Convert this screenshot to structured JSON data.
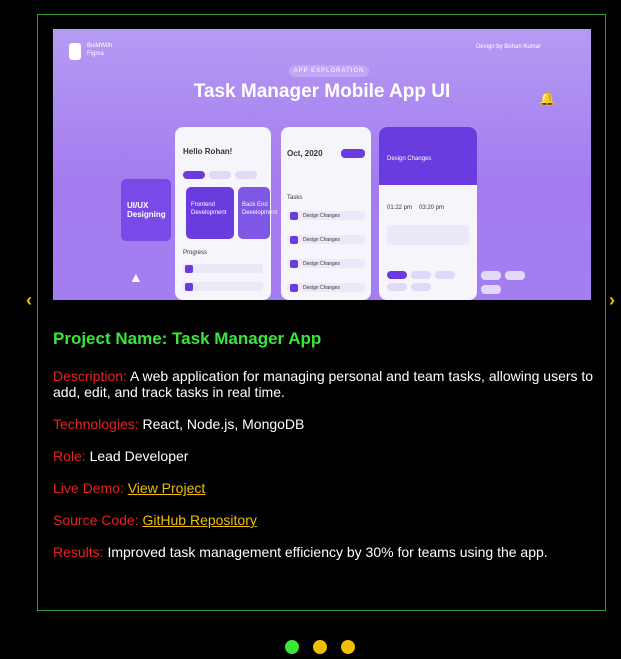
{
  "hero": {
    "logo_text": "BuildWith\nFigma",
    "design_by": "Design by Bohan Kumar",
    "badge": "APP EXPLORATION",
    "title": "Task Manager Mobile App UI",
    "phone1": {
      "greeting": "Hello Rohan!",
      "section": "Progress",
      "tile1": "UI/UX Designing",
      "tile2": "Frontend Development",
      "tile3": "Back End Development"
    },
    "phone2": {
      "month": "Oct, 2020",
      "section": "Tasks",
      "items": [
        "Design Changes",
        "Design Changes",
        "Design Changes",
        "Design Changes"
      ]
    },
    "phone3": {
      "header": "Design Changes",
      "time1": "01:22 pm",
      "time2": "03:20 pm"
    }
  },
  "project": {
    "name": "Project Name: Task Manager App",
    "description_label": "Description:",
    "description": "A web application for managing personal and team tasks, allowing users to add, edit, and track tasks in real time.",
    "technologies_label": "Technologies:",
    "technologies": "React, Node.js, MongoDB",
    "role_label": "Role:",
    "role": "Lead Developer",
    "demo_label": "Live Demo:",
    "demo_link": "View Project",
    "source_label": "Source Code:",
    "source_link": "GitHub Repository",
    "results_label": "Results:",
    "results": "Improved task management efficiency by 30% for teams using the app."
  },
  "carousel": {
    "prev": "‹",
    "next": "›",
    "active_index": 0,
    "dot_colors": [
      "#39e639",
      "#f0c000",
      "#f0c000"
    ]
  }
}
